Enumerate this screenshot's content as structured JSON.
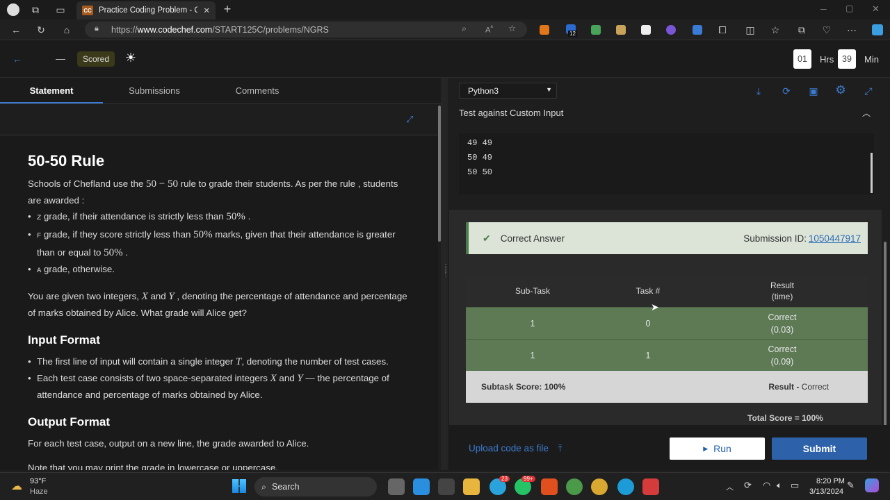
{
  "browser": {
    "tab_title": "Practice Coding Problem - Code",
    "tab_favicon": "CC",
    "url_prefix": "https://",
    "url_host": "www.codechef.com",
    "url_path": "/START125C/problems/NGRS",
    "ext_badge": "12"
  },
  "header": {
    "scored_label": "Scored",
    "hours": "01",
    "hours_label": "Hrs",
    "minutes": "39",
    "minutes_label": "Min"
  },
  "left_tabs": [
    "Statement",
    "Submissions",
    "Comments"
  ],
  "statement": {
    "title": "50-50 Rule",
    "intro_a": "Schools of Chefland use the ",
    "intro_math": "50 − 50",
    "intro_b": " rule to grade their students. As per the rule , students are awarded :",
    "bullets": [
      {
        "code": "Z",
        "a": " grade, if their attendance is strictly less than ",
        "math": "50%",
        "b": " ."
      },
      {
        "code": "F",
        "a": " grade, if they score strictly less than ",
        "math": "50%",
        "b": " marks, given that their attendance is greater than or equal to ",
        "math2": "50%",
        "c": " ."
      },
      {
        "code": "A",
        "a": " grade, otherwise."
      }
    ],
    "given_a": "You are given two integers, ",
    "given_x": "X",
    "given_b": " and ",
    "given_y": "Y",
    "given_c": " , denoting the percentage of attendance and percentage of marks obtained by Alice. What grade will Alice get?",
    "input_heading": "Input Format",
    "input_1a": "The first line of input will contain a single integer ",
    "input_1t": "T",
    "input_1b": ", denoting the number of test cases.",
    "input_2a": "Each test case consists of two space-separated integers ",
    "input_2x": "X",
    "input_2b": " and ",
    "input_2y": "Y",
    "input_2c": " — the percentage of attendance and percentage of marks obtained by Alice.",
    "output_heading": "Output Format",
    "output_1": "For each test case, output on a new line, the grade awarded to Alice.",
    "output_2": "Note that you may print the grade in lowercase or uppercase."
  },
  "editor": {
    "language": "Python3",
    "custom_input_label": "Test against Custom Input",
    "custom_input_lines": [
      "49 49",
      "50 49",
      "50 50"
    ]
  },
  "result": {
    "status": "Correct Answer",
    "submission_label": "Submission ID:",
    "submission_id": "1050447917",
    "headers": [
      "Sub-Task",
      "Task #",
      "Result\n(time)"
    ],
    "rows": [
      {
        "subtask": "1",
        "task": "0",
        "result": "Correct",
        "time": "(0.03)"
      },
      {
        "subtask": "1",
        "task": "1",
        "result": "Correct",
        "time": "(0.09)"
      }
    ],
    "subtask_score": "Subtask Score: 100%",
    "result_label": "Result - ",
    "result_value": "Correct",
    "total": "Total Score = 100%"
  },
  "actions": {
    "upload": "Upload code as file",
    "run": "Run",
    "submit": "Submit"
  },
  "taskbar": {
    "weather_temp": "93°F",
    "weather_desc": "Haze",
    "search": "Search",
    "time": "8:20 PM",
    "date": "3/13/2024",
    "badge_mail": "23",
    "badge_whatsapp": "99+"
  }
}
